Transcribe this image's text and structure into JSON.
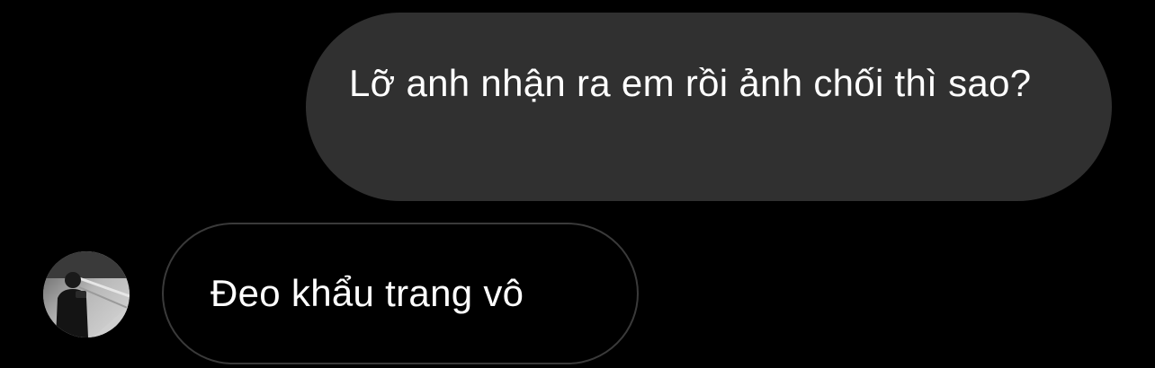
{
  "conversation": {
    "messages": [
      {
        "direction": "outgoing",
        "text": "Lỡ anh nhận ra em rồi ảnh chối thì sao?"
      },
      {
        "direction": "incoming",
        "text": "Đeo khẩu trang vô",
        "avatar": "user-avatar-photo"
      }
    ]
  },
  "colors": {
    "background": "#000000",
    "outgoing_bubble": "#303030",
    "incoming_bubble_border": "#3a3a3a",
    "text": "#ffffff"
  }
}
